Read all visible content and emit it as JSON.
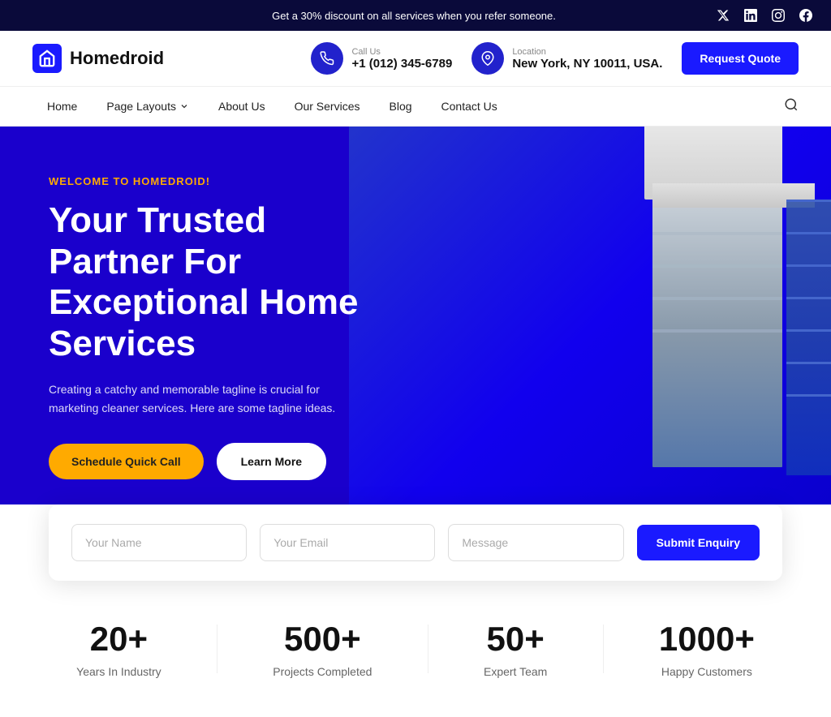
{
  "top_banner": {
    "message": "Get a 30% discount on all services when you refer someone.",
    "social": [
      "twitter-x",
      "linkedin",
      "instagram",
      "facebook"
    ]
  },
  "header": {
    "logo_text": "Homedroid",
    "call_label": "Call Us",
    "phone": "+1 (012) 345-6789",
    "location_label": "Location",
    "address": "New York, NY 10011, USA.",
    "request_btn": "Request Quote"
  },
  "nav": {
    "links": [
      "Home",
      "Page Layouts",
      "About Us",
      "Our Services",
      "Blog",
      "Contact Us"
    ],
    "has_dropdown": [
      false,
      true,
      false,
      false,
      false,
      false
    ]
  },
  "hero": {
    "tagline": "WELCOME TO HOMEDROID!",
    "title": "Your Trusted Partner For Exceptional Home Services",
    "description": "Creating a catchy and memorable tagline is crucial for marketing cleaner services. Here are some tagline ideas.",
    "btn_primary": "Schedule Quick Call",
    "btn_secondary": "Learn More"
  },
  "enquiry": {
    "name_placeholder": "Your Name",
    "email_placeholder": "Your Email",
    "message_placeholder": "Message",
    "submit_label": "Submit Enquiry"
  },
  "stats": [
    {
      "number": "20+",
      "label": "Years In Industry"
    },
    {
      "number": "500+",
      "label": "Projects Completed"
    },
    {
      "number": "50+",
      "label": "Expert Team"
    },
    {
      "number": "1000+",
      "label": "Happy Customers"
    }
  ],
  "colors": {
    "brand_blue": "#1a1aff",
    "brand_yellow": "#ffaa00",
    "dark_navy": "#0a0a3a",
    "text_dark": "#111111"
  }
}
